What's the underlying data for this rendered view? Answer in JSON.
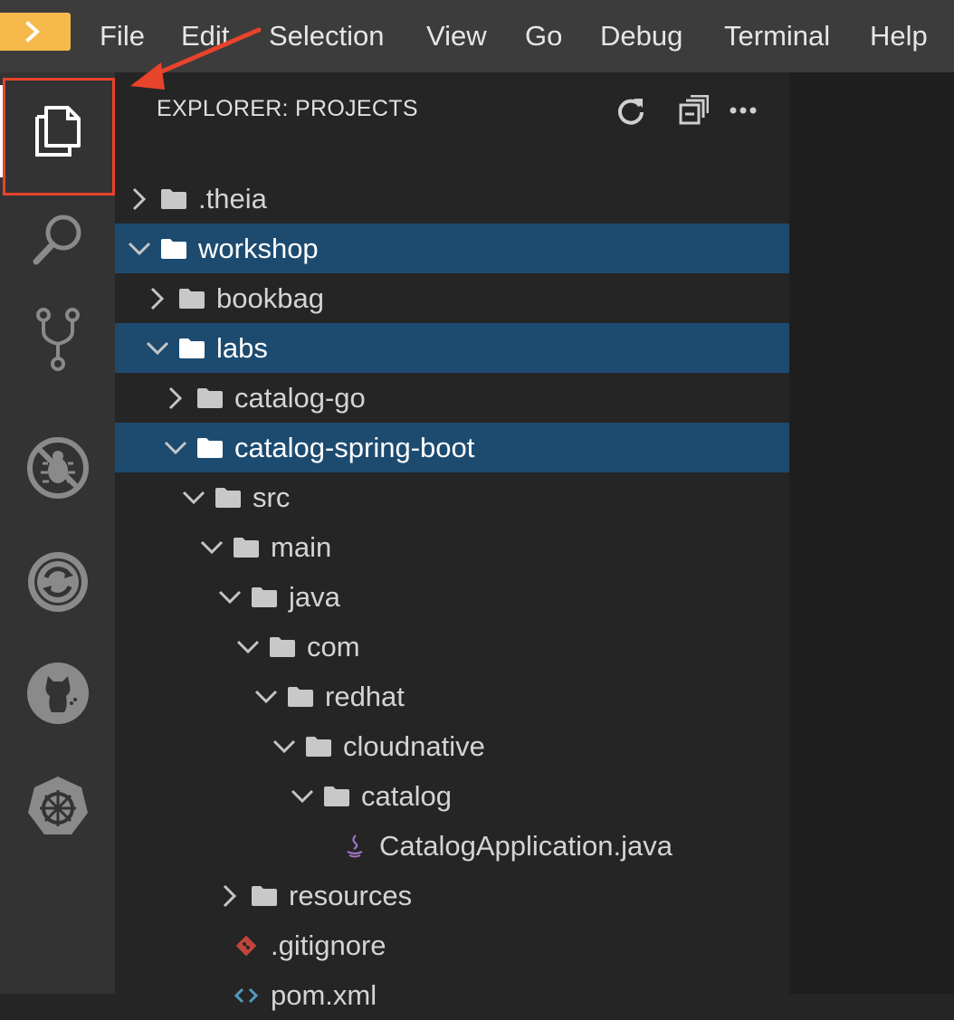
{
  "menubar": {
    "items": [
      "File",
      "Edit",
      "Selection",
      "View",
      "Go",
      "Debug",
      "Terminal",
      "Help"
    ]
  },
  "activitybar": {
    "icons": [
      "files-icon",
      "search-icon",
      "source-control-icon",
      "debug-disabled-icon",
      "openshift-icon",
      "github-cat-icon",
      "kubernetes-helm-icon"
    ]
  },
  "explorer": {
    "title": "EXPLORER: PROJECTS",
    "actions": [
      "refresh-icon",
      "collapse-all-icon",
      "more-icon"
    ]
  },
  "tree": [
    {
      "label": ".theia",
      "depth": 0,
      "kind": "folder",
      "expanded": false,
      "selected": false
    },
    {
      "label": "workshop",
      "depth": 0,
      "kind": "folder",
      "expanded": true,
      "selected": true
    },
    {
      "label": "bookbag",
      "depth": 1,
      "kind": "folder",
      "expanded": false,
      "selected": false
    },
    {
      "label": "labs",
      "depth": 1,
      "kind": "folder",
      "expanded": true,
      "selected": true
    },
    {
      "label": "catalog-go",
      "depth": 2,
      "kind": "folder",
      "expanded": false,
      "selected": false
    },
    {
      "label": "catalog-spring-boot",
      "depth": 2,
      "kind": "folder",
      "expanded": true,
      "selected": true
    },
    {
      "label": "src",
      "depth": 3,
      "kind": "folder",
      "expanded": true,
      "selected": false
    },
    {
      "label": "main",
      "depth": 4,
      "kind": "folder",
      "expanded": true,
      "selected": false
    },
    {
      "label": "java",
      "depth": 5,
      "kind": "folder",
      "expanded": true,
      "selected": false
    },
    {
      "label": "com",
      "depth": 6,
      "kind": "folder",
      "expanded": true,
      "selected": false
    },
    {
      "label": "redhat",
      "depth": 7,
      "kind": "folder",
      "expanded": true,
      "selected": false
    },
    {
      "label": "cloudnative",
      "depth": 8,
      "kind": "folder",
      "expanded": true,
      "selected": false
    },
    {
      "label": "catalog",
      "depth": 9,
      "kind": "folder",
      "expanded": true,
      "selected": false
    },
    {
      "label": "CatalogApplication.java",
      "depth": 10,
      "kind": "java",
      "selected": false
    },
    {
      "label": "resources",
      "depth": 5,
      "kind": "folder",
      "expanded": false,
      "selected": false
    },
    {
      "label": ".gitignore",
      "depth": 4,
      "kind": "git",
      "selected": false
    },
    {
      "label": "pom.xml",
      "depth": 4,
      "kind": "xml",
      "selected": false
    }
  ],
  "colors": {
    "accent": "#f6b94b",
    "selection": "#1d4b70",
    "annotation": "#e8432b"
  }
}
